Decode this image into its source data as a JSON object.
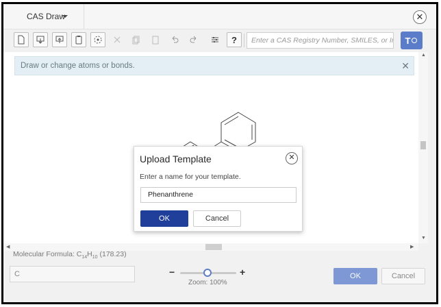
{
  "window": {
    "title": "CAS Draw",
    "close_label": "✕"
  },
  "toolbar": {
    "search_placeholder": "Enter a CAS Registry Number, SMILES, or InChI...",
    "help_label": "?",
    "template_label": "T",
    "icons": [
      "new-file-icon",
      "import-icon",
      "export-icon",
      "clipboard-icon",
      "select-icon",
      "cut-icon",
      "copy-icon",
      "paste-icon",
      "undo-icon",
      "redo-icon",
      "settings-icon",
      "help-icon"
    ]
  },
  "banner": {
    "text": "Draw or change atoms or bonds.",
    "close_label": "✕"
  },
  "formula": {
    "label": "Molecular Formula: ",
    "element1": "C",
    "sub1": "14",
    "element2": "H",
    "sub2": "10",
    "mass": " (178.23)"
  },
  "bottom": {
    "input_value": "C",
    "zoom_minus": "−",
    "zoom_plus": "+",
    "zoom_label": "Zoom: 100%",
    "ok_label": "OK",
    "cancel_label": "Cancel"
  },
  "modal": {
    "title": "Upload Template",
    "close_label": "✕",
    "description": "Enter a name for your template.",
    "input_value": "Phenanthrene",
    "ok_label": "OK",
    "cancel_label": "Cancel"
  },
  "colors": {
    "accent": "#1f3f9b",
    "accent_light": "#7e97d5",
    "banner_bg": "#e3eff4"
  }
}
